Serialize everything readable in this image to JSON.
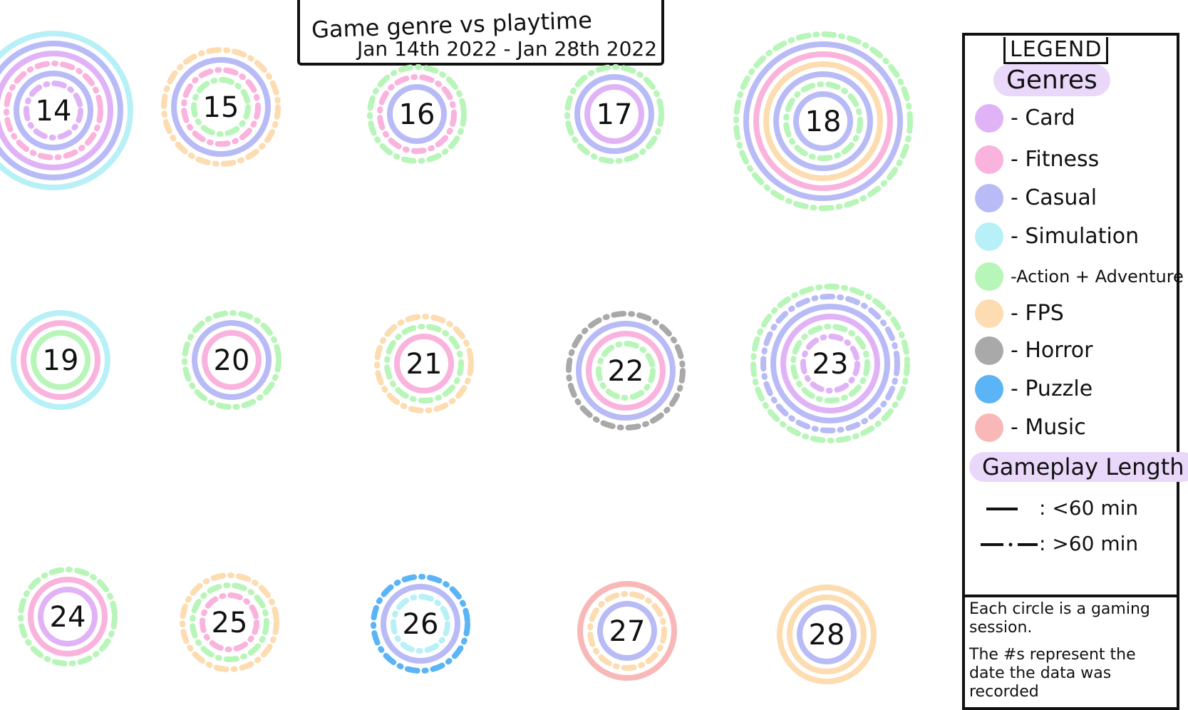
{
  "title": {
    "line1": "Game genre vs playtime",
    "line2": "Jan 14th 2022 - Jan 28th 2022"
  },
  "legend": {
    "heading": "LEGEND",
    "genres_heading": "Genres",
    "genres": [
      {
        "key": "card",
        "label": "- Card",
        "color": "#e0b3f7"
      },
      {
        "key": "fitness",
        "label": "- Fitness",
        "color": "#f9b3dc"
      },
      {
        "key": "casual",
        "label": "- Casual",
        "color": "#b8bbf5"
      },
      {
        "key": "simulation",
        "label": "- Simulation",
        "color": "#b8f0f7"
      },
      {
        "key": "action",
        "label": "-Action + Adventure",
        "color": "#b8f5b8"
      },
      {
        "key": "fps",
        "label": "- FPS",
        "color": "#fcdcb0"
      },
      {
        "key": "horror",
        "label": "- Horror",
        "color": "#a9a9a9"
      },
      {
        "key": "puzzle",
        "label": "- Puzzle",
        "color": "#5ab4f5"
      },
      {
        "key": "music",
        "label": "- Music",
        "color": "#f9b8b8"
      }
    ],
    "length_heading": "Gameplay Length",
    "lengths": [
      {
        "key": "short",
        "label": ": <60 min"
      },
      {
        "key": "long",
        "label": ": >60 min"
      }
    ],
    "notes": [
      "Each circle is a gaming session.",
      "The #s represent the date the data was recorded"
    ]
  },
  "chart_data": {
    "type": "other",
    "days": [
      {
        "day": "14",
        "rings": [
          [
            "card",
            "long"
          ],
          [
            "casual",
            "short"
          ],
          [
            "fitness",
            "long"
          ],
          [
            "card",
            "short"
          ],
          [
            "casual",
            "short"
          ],
          [
            "simulation",
            "short"
          ]
        ]
      },
      {
        "day": "15",
        "rings": [
          [
            "action",
            "long"
          ],
          [
            "fitness",
            "long"
          ],
          [
            "casual",
            "short"
          ],
          [
            "fps",
            "long"
          ]
        ]
      },
      {
        "day": "16",
        "rings": [
          [
            "casual",
            "short"
          ],
          [
            "fitness",
            "long"
          ],
          [
            "action",
            "long"
          ]
        ]
      },
      {
        "day": "17",
        "rings": [
          [
            "card",
            "short"
          ],
          [
            "casual",
            "short"
          ],
          [
            "action",
            "long"
          ]
        ]
      },
      {
        "day": "18",
        "rings": [
          [
            "casual",
            "short"
          ],
          [
            "action",
            "long"
          ],
          [
            "casual",
            "short"
          ],
          [
            "fps",
            "short"
          ],
          [
            "fitness",
            "short"
          ],
          [
            "casual",
            "short"
          ],
          [
            "action",
            "long"
          ]
        ]
      },
      {
        "day": "19",
        "rings": [
          [
            "action",
            "short"
          ],
          [
            "fitness",
            "short"
          ],
          [
            "simulation",
            "short"
          ]
        ]
      },
      {
        "day": "20",
        "rings": [
          [
            "fitness",
            "short"
          ],
          [
            "casual",
            "short"
          ],
          [
            "action",
            "long"
          ]
        ]
      },
      {
        "day": "21",
        "rings": [
          [
            "fitness",
            "short"
          ],
          [
            "action",
            "long"
          ],
          [
            "fps",
            "long"
          ]
        ]
      },
      {
        "day": "22",
        "rings": [
          [
            "action",
            "long"
          ],
          [
            "fitness",
            "short"
          ],
          [
            "casual",
            "short"
          ],
          [
            "horror",
            "long"
          ]
        ]
      },
      {
        "day": "23",
        "rings": [
          [
            "card",
            "long"
          ],
          [
            "action",
            "long"
          ],
          [
            "card",
            "short"
          ],
          [
            "casual",
            "short"
          ],
          [
            "casual",
            "long"
          ],
          [
            "action",
            "long"
          ]
        ]
      },
      {
        "day": "24",
        "rings": [
          [
            "card",
            "short"
          ],
          [
            "fitness",
            "short"
          ],
          [
            "action",
            "long"
          ]
        ]
      },
      {
        "day": "25",
        "rings": [
          [
            "fitness",
            "long"
          ],
          [
            "action",
            "long"
          ],
          [
            "fps",
            "long"
          ]
        ]
      },
      {
        "day": "26",
        "rings": [
          [
            "simulation",
            "long"
          ],
          [
            "casual",
            "short"
          ],
          [
            "puzzle",
            "long"
          ]
        ]
      },
      {
        "day": "27",
        "rings": [
          [
            "casual",
            "short"
          ],
          [
            "fps",
            "long"
          ],
          [
            "music",
            "short"
          ]
        ]
      },
      {
        "day": "28",
        "rings": [
          [
            "casual",
            "short"
          ],
          [
            "fps",
            "short"
          ],
          [
            "fps",
            "short"
          ]
        ]
      }
    ]
  }
}
